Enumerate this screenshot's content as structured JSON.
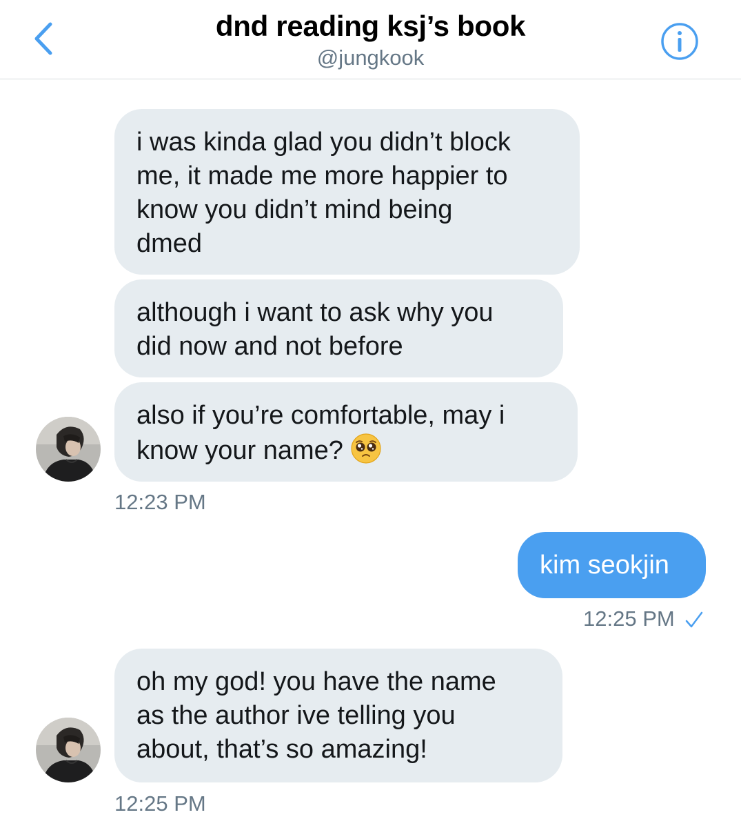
{
  "header": {
    "title": "dnd reading ksj’s book",
    "handle": "@jungkook",
    "back_icon": "chevron-left-icon",
    "info_icon": "info-circle-icon",
    "accent_color": "#4a9ff0"
  },
  "messages": [
    {
      "direction": "incoming",
      "lines": [
        "i was kinda glad you didn’t block",
        "me, it made me more happier to",
        "know you didn’t mind being",
        "dmed"
      ]
    },
    {
      "direction": "incoming",
      "lines": [
        "although i want to ask why you",
        "did now and not before"
      ]
    },
    {
      "direction": "incoming",
      "lines": [
        "also if you’re comfortable, may i",
        "know your name?"
      ],
      "emoji": "pleading-face-emoji",
      "timestamp": "12:23 PM"
    },
    {
      "direction": "outgoing",
      "lines": [
        "kim seokjin"
      ],
      "timestamp": "12:25 PM",
      "status_icon": "checkmark-icon"
    },
    {
      "direction": "incoming",
      "lines": [
        "oh my god! you have the name",
        "as the author ive telling you",
        "about, that’s so amazing!"
      ],
      "timestamp": "12:25 PM"
    }
  ]
}
